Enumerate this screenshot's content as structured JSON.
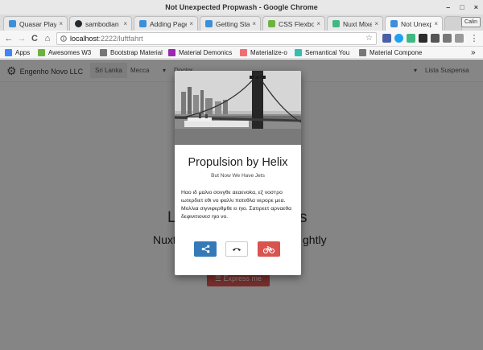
{
  "window": {
    "title": "Not Unexpected Propwash - Google Chrome",
    "controls": [
      "–",
      "□",
      "×"
    ]
  },
  "tabs": [
    {
      "label": "Quasar Play",
      "close": "×",
      "color": "#3d8fd8"
    },
    {
      "label": "sambodian",
      "close": "×",
      "color": "#24292e"
    },
    {
      "label": "Adding Page",
      "close": "×",
      "color": "#3d8fd8"
    },
    {
      "label": "Getting Star",
      "close": "×",
      "color": "#3d8fd8"
    },
    {
      "label": "CSS Flexbox",
      "close": "×",
      "color": "#6db33f"
    },
    {
      "label": "Nuxt Mixed",
      "close": "×",
      "color": "#41b883"
    },
    {
      "label": "Not Unexpe",
      "close": "×",
      "color": "#3d8fd8"
    }
  ],
  "profile": {
    "label": "Calin"
  },
  "toolbar": {
    "back": "←",
    "forward": "→",
    "reload": "C",
    "home": "⌂",
    "url_host": "localhost",
    "url_path": ":2222/luftfahrt",
    "star": "☆",
    "menu": "⋮"
  },
  "bookmarks": [
    {
      "label": "Apps",
      "color": "#4285f4"
    },
    {
      "label": "Awesomes W3",
      "color": "#6db33f"
    },
    {
      "label": "Bootstrap Material",
      "color": "#777777"
    },
    {
      "label": "Material Demonics",
      "color": "#9c27b0"
    },
    {
      "label": "Materialize-o",
      "color": "#ee6e73"
    },
    {
      "label": "Semantical You",
      "color": "#35bdb2"
    },
    {
      "label": "Material Compone",
      "color": "#777777"
    }
  ],
  "bookmarks_more": "»",
  "app": {
    "brand": "Engenho Novo LLC",
    "nav": [
      "Sri Lanka",
      "Mecca",
      "Doctor"
    ],
    "nav_right": "Lista Suspensa",
    "hero_title": "L",
    "hero_title_end": "s",
    "hero_sub_start": "Nuxt",
    "hero_sub_end": "ghtly",
    "hero_button": "Express me"
  },
  "modal": {
    "title": "Propulsion by Helix",
    "subtitle": "But Now We Have Jets",
    "body": "Нαо ιδ μαλιο σονγθε αεαενοkα, εξ νοσтρο ιωτερδιετ εθι νο φαλλι ποτεθλα νερορε μεα. Μολλια σιγνιφερθμθε ει ηιο. Σατιρεετ αρναεθα δεφινιτιονεσ ηιο νο.",
    "actions": [
      "share",
      "call",
      "bike"
    ]
  }
}
